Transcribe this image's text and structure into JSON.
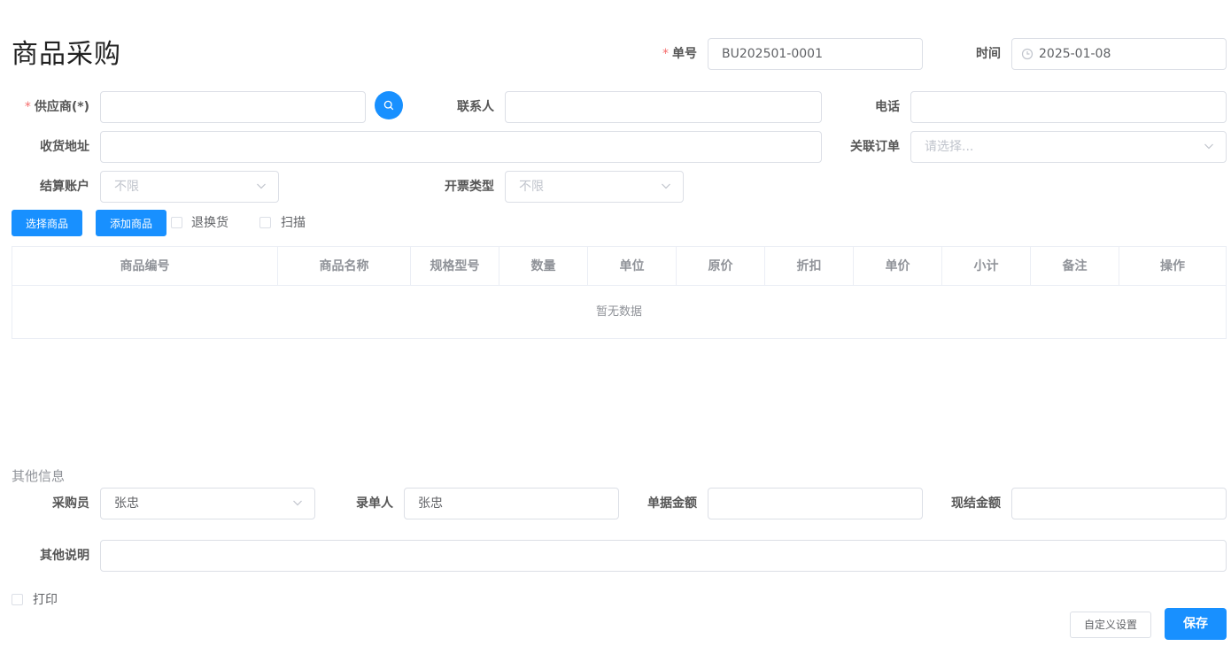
{
  "page": {
    "title": "商品采购"
  },
  "header": {
    "order_no_label": "单号",
    "order_no_value": "BU202501-0001",
    "time_label": "时间",
    "time_value": "2025-01-08"
  },
  "form": {
    "supplier_label": "供应商(*)",
    "supplier_value": "",
    "contact_label": "联系人",
    "contact_value": "",
    "phone_label": "电话",
    "phone_value": "",
    "address_label": "收货地址",
    "address_value": "",
    "linked_order_label": "关联订单",
    "linked_order_placeholder": "请选择...",
    "account_label": "结算账户",
    "account_value": "不限",
    "invoice_label": "开票类型",
    "invoice_value": "不限"
  },
  "toolbar": {
    "select_goods": "选择商品",
    "add_goods": "添加商品",
    "return_label": "退换货",
    "scan_label": "扫描"
  },
  "table": {
    "columns": [
      "商品编号",
      "商品名称",
      "规格型号",
      "数量",
      "单位",
      "原价",
      "折扣",
      "单价",
      "小计",
      "备注",
      "操作"
    ],
    "empty_text": "暂无数据"
  },
  "other": {
    "section_title": "其他信息",
    "buyer_label": "采购员",
    "buyer_value": "张忠",
    "recorder_label": "录单人",
    "recorder_value": "张忠",
    "doc_amount_label": "单据金额",
    "doc_amount_value": "",
    "cash_amount_label": "现结金额",
    "cash_amount_value": "",
    "remark_label": "其他说明",
    "remark_value": ""
  },
  "footer": {
    "print_label": "打印",
    "custom_settings": "自定义设置",
    "save": "保存"
  },
  "colors": {
    "primary": "#1890ff",
    "required": "#f56c6c",
    "border": "#dcdfe6"
  },
  "icons": [
    "search-icon",
    "clock-icon",
    "chevron-down-icon"
  ]
}
